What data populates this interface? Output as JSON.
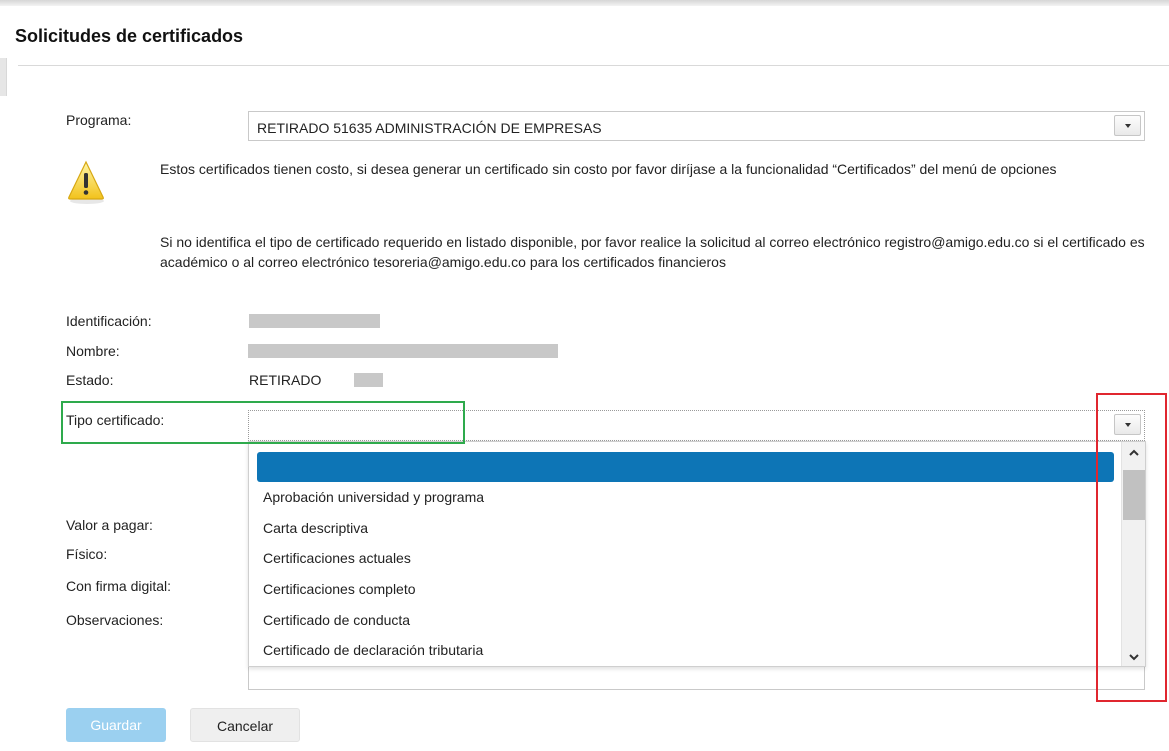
{
  "page": {
    "title": "Solicitudes de certificados"
  },
  "form": {
    "programa_label": "Programa:",
    "programa_value": "RETIRADO 51635 ADMINISTRACIÓN DE EMPRESAS",
    "notice_1": "Estos certificados tienen costo, si desea generar un certificado sin costo por favor diríjase a la funcionalidad “Certificados” del menú de opciones",
    "notice_2": "Si no identifica el tipo de certificado requerido en listado disponible, por favor realice la solicitud al correo electrónico registro@amigo.edu.co si el certificado es académico o al correo electrónico tesoreria@amigo.edu.co para los certificados financieros",
    "identificacion_label": "Identificación:",
    "nombre_label": "Nombre:",
    "estado_label": "Estado:",
    "estado_value": "RETIRADO",
    "tipo_label": "Tipo certificado:",
    "tipo_value": "",
    "valor_label": "Valor a pagar:",
    "fisico_label": "Físico:",
    "firma_label": "Con firma digital:",
    "observaciones_label": "Observaciones:"
  },
  "dropdown": {
    "selected_index": 0,
    "options": [
      "",
      "Aprobación universidad y programa",
      "Carta descriptiva",
      "Certificaciones actuales",
      "Certificaciones completo",
      "Certificado de conducta",
      "Certificado de declaración tributaria"
    ],
    "selected_color": "#0d75b6"
  },
  "buttons": {
    "save": "Guardar",
    "cancel": "Cancelar"
  },
  "colors": {
    "highlight_green": "#2eaa4c",
    "highlight_red": "#e0262f",
    "save_button": "#9bd0f0"
  },
  "icons": {
    "warning": "warning-icon",
    "chevron": "chevron-down-icon",
    "scroll_up": "chevron-up-icon",
    "scroll_down": "chevron-down-icon"
  }
}
